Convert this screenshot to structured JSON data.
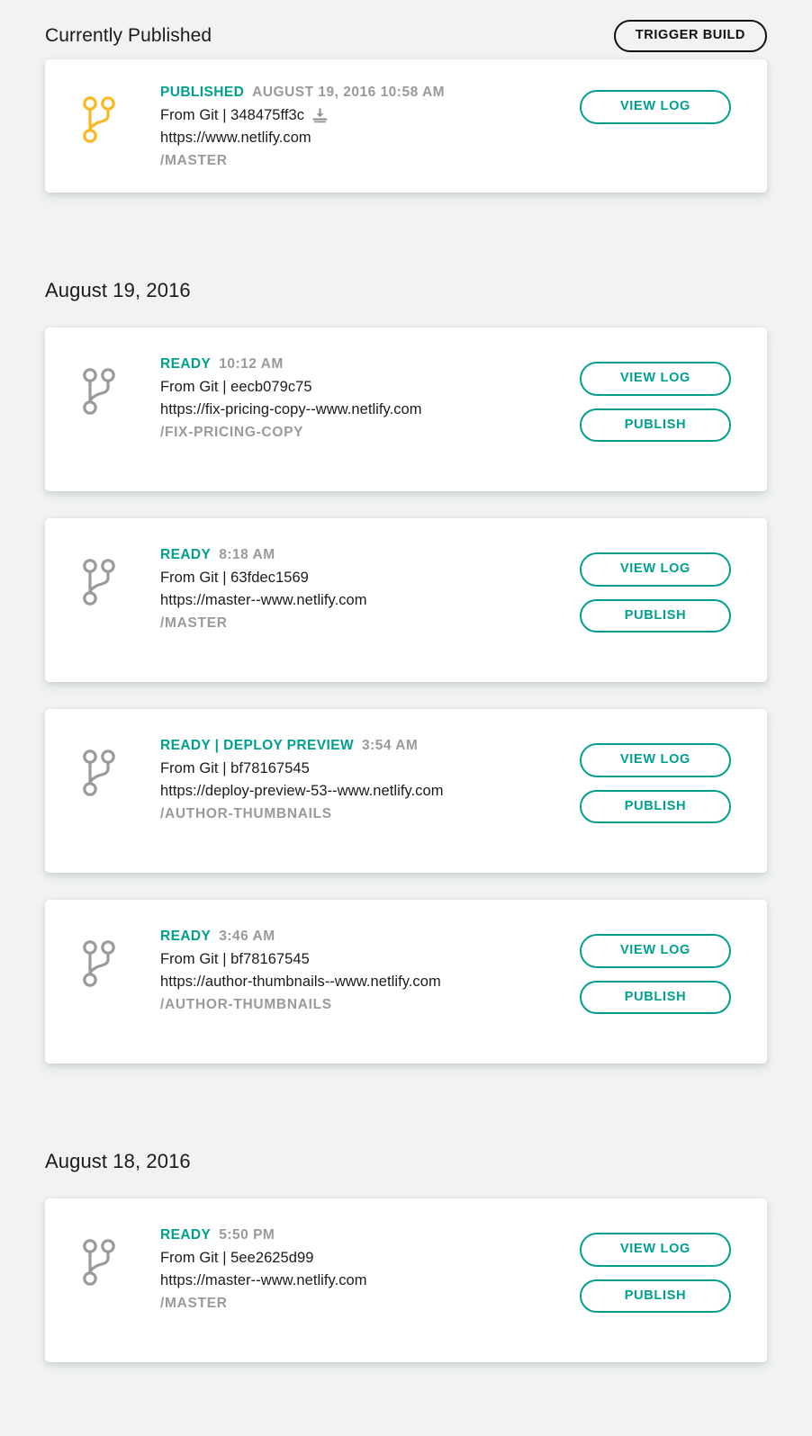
{
  "header": {
    "title": "Currently Published",
    "trigger_build_label": "TRIGGER BUILD"
  },
  "colors": {
    "background": "#f1f3f3",
    "card": "#ffffff",
    "accent_teal": "#00a08e",
    "published_icon": "#fbb724",
    "default_icon": "#9a9a9a",
    "muted_text": "#9a9a9a",
    "body_text": "#1b1b1b"
  },
  "labels": {
    "view_log": "VIEW LOG",
    "publish": "PUBLISH"
  },
  "published_section": {
    "deploy": {
      "status": "PUBLISHED",
      "time": "AUGUST 19, 2016 10:58 AM",
      "git": "From Git | 348475ff3c",
      "has_download": true,
      "url": "https://www.netlify.com",
      "branch": "/MASTER",
      "icon_color": "#fbb724",
      "actions": [
        "VIEW LOG"
      ]
    }
  },
  "sections": [
    {
      "date": "August 19, 2016",
      "deploys": [
        {
          "status": "READY",
          "time": "10:12 AM",
          "git": "From Git | eecb079c75",
          "has_download": false,
          "url": "https://fix-pricing-copy--www.netlify.com",
          "branch": "/FIX-PRICING-COPY",
          "icon_color": "#9a9a9a",
          "actions": [
            "VIEW LOG",
            "PUBLISH"
          ]
        },
        {
          "status": "READY",
          "time": "8:18 AM",
          "git": "From Git | 63fdec1569",
          "has_download": false,
          "url": "https://master--www.netlify.com",
          "branch": "/MASTER",
          "icon_color": "#9a9a9a",
          "actions": [
            "VIEW LOG",
            "PUBLISH"
          ]
        },
        {
          "status": "READY | DEPLOY PREVIEW",
          "time": "3:54 AM",
          "git": "From Git | bf78167545",
          "has_download": false,
          "url": "https://deploy-preview-53--www.netlify.com",
          "branch": "/AUTHOR-THUMBNAILS",
          "icon_color": "#9a9a9a",
          "actions": [
            "VIEW LOG",
            "PUBLISH"
          ]
        },
        {
          "status": "READY",
          "time": "3:46 AM",
          "git": "From Git | bf78167545",
          "has_download": false,
          "url": "https://author-thumbnails--www.netlify.com",
          "branch": "/AUTHOR-THUMBNAILS",
          "icon_color": "#9a9a9a",
          "actions": [
            "VIEW LOG",
            "PUBLISH"
          ]
        }
      ]
    },
    {
      "date": "August 18, 2016",
      "deploys": [
        {
          "status": "READY",
          "time": "5:50 PM",
          "git": "From Git | 5ee2625d99",
          "has_download": false,
          "url": "https://master--www.netlify.com",
          "branch": "/MASTER",
          "icon_color": "#9a9a9a",
          "actions": [
            "VIEW LOG",
            "PUBLISH"
          ]
        }
      ]
    }
  ],
  "icons": {
    "branch": "git-branch-icon",
    "download": "download-icon"
  }
}
